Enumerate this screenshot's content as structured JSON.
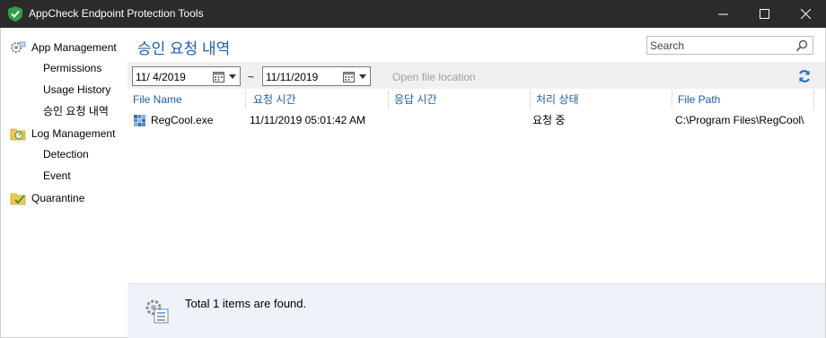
{
  "window": {
    "title": "AppCheck Endpoint Protection Tools"
  },
  "sidebar": {
    "groups": [
      {
        "label": "App Management",
        "icon": "gear-apps-icon",
        "items": [
          "Permissions",
          "Usage History",
          "승인 요청 내역"
        ]
      },
      {
        "label": "Log Management",
        "icon": "log-folder-icon",
        "items": [
          "Detection",
          "Event"
        ]
      },
      {
        "label": "Quarantine",
        "icon": "quarantine-folder-icon",
        "items": []
      }
    ]
  },
  "main": {
    "page_title": "승인 요청 내역",
    "search": {
      "placeholder": "Search",
      "value": ""
    },
    "toolbar": {
      "date_from": "11/  4/2019",
      "separator": "~",
      "date_to": "11/11/2019",
      "open_file_location": "Open file location"
    },
    "columns": [
      "File Name",
      "요청 시간",
      "응답 시간",
      "처리 상태",
      "File Path"
    ],
    "rows": [
      {
        "file_name": "RegCool.exe",
        "request_time": "11/11/2019 05:01:42 AM",
        "response_time": "",
        "status": "요청 중",
        "file_path": "C:\\Program Files\\RegCool\\"
      }
    ],
    "status_text": "Total 1 items are found."
  },
  "colors": {
    "accent": "#1f5fa8",
    "titlebar": "#2b2b2b",
    "status_bg": "#eef3f9",
    "toolbar_bg": "#f0f0f0"
  }
}
